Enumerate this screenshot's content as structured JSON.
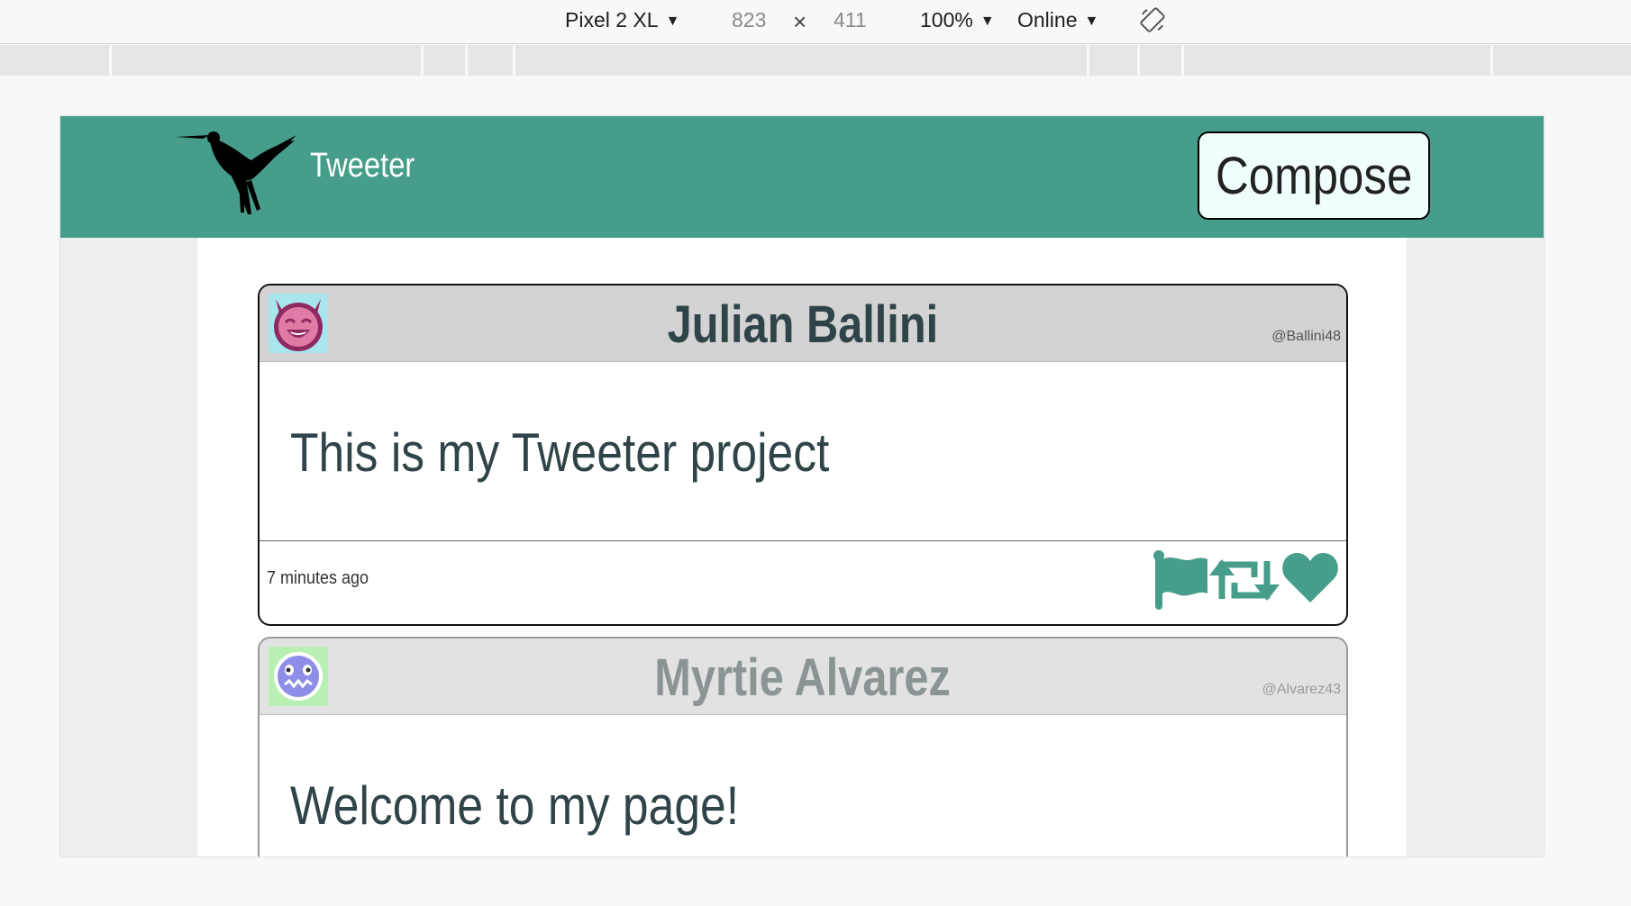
{
  "devtools": {
    "device": "Pixel 2 XL",
    "width": "823",
    "times": "×",
    "height": "411",
    "zoom": "100%",
    "network": "Online",
    "caret": "▼"
  },
  "nav": {
    "brand": "Tweeter",
    "compose_label": "Compose",
    "bg_color": "#469d89"
  },
  "tweets": [
    {
      "name": "Julian Ballini",
      "handle": "@Ballini48",
      "text": "This is my Tweeter project",
      "time": "7 minutes ago",
      "avatar": "devil-smiley-avatar"
    },
    {
      "name": "Myrtie Alvarez",
      "handle": "@Alvarez43",
      "text": "Welcome to my page!",
      "avatar": "monster-face-avatar"
    }
  ],
  "icons": {
    "flag": "flag-icon",
    "retweet": "retweet-icon",
    "like": "heart-icon",
    "accent": "#469d89"
  }
}
